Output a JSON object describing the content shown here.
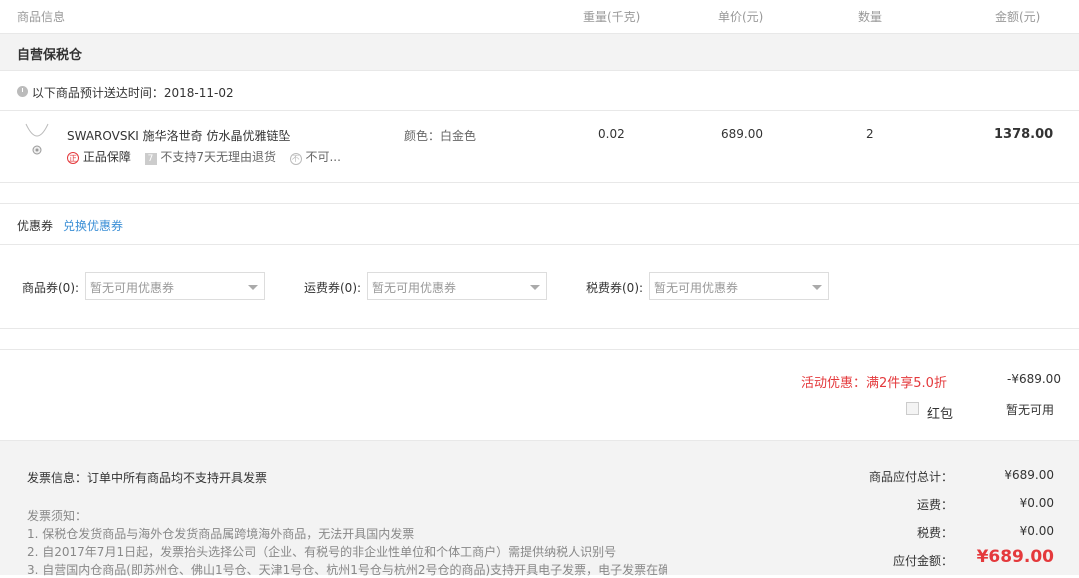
{
  "table_header": {
    "product_info": "商品信息",
    "weight": "重量(千克)",
    "unit_price": "单价(元)",
    "quantity": "数量",
    "amount": "金额(元)"
  },
  "warehouse": {
    "title": "自营保税仓",
    "delivery_label": "以下商品预计送达时间：",
    "delivery_date": "2018-11-02"
  },
  "product": {
    "name": "SWAROVSKI 施华洛世奇 仿水晶优雅链坠",
    "color": "颜色：白金色",
    "weight": "0.02",
    "unit_price": "689.00",
    "quantity": "2",
    "amount": "1378.00",
    "tags": [
      "正品保障",
      "不支持7天无理由退货",
      "不可..."
    ],
    "tag_glyphs": [
      "正",
      "7",
      "不"
    ]
  },
  "coupon": {
    "title": "优惠券",
    "exchange_link": "兑换优惠券",
    "product_label": "商品券(0):",
    "shipping_label": "运费券(0):",
    "tax_label": "税费券(0):",
    "placeholder": "暂无可用优惠券"
  },
  "promotion": {
    "label": "活动优惠：满2件享5.0折",
    "value": "-¥689.00",
    "red_packet_label": "红包",
    "red_packet_value": "暂无可用"
  },
  "invoice": {
    "info": "发票信息：订单中所有商品均不支持开具发票",
    "notice_title": "发票须知：",
    "notes": [
      "1. 保税仓发货商品与海外仓发货商品属跨境海外商品，无法开具国内发票",
      "2. 自2017年7月1日起，发票抬头选择公司（企业、有税号的非企业性单位和个体工商户）需提供纳税人识别号",
      "3. 自营国内仓商品(即苏州仓、佛山1号仓、天津1号仓、杭州1号仓与杭州2号仓的商品)支持开具电子发票，电子发票在确"
    ]
  },
  "summary": {
    "subtotal_label": "商品应付总计：",
    "subtotal": "¥689.00",
    "shipping_label": "运费：",
    "shipping": "¥0.00",
    "tax_label": "税费：",
    "tax": "¥0.00",
    "total_label": "应付金额：",
    "total": "¥689.00"
  },
  "colors": {
    "accent_red": "#e4393c",
    "link_blue": "#3b8fd6",
    "band_gray": "#f3f3f3"
  }
}
